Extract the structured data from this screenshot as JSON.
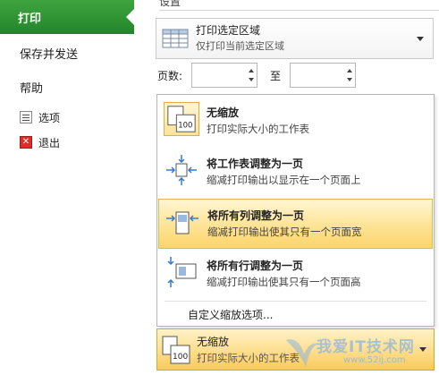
{
  "nav": {
    "items": [
      {
        "label": "打印",
        "active": true
      },
      {
        "label": "保存并发送"
      },
      {
        "label": "帮助"
      },
      {
        "label": "选项",
        "icon": "options-icon"
      },
      {
        "label": "退出",
        "icon": "exit-icon"
      }
    ]
  },
  "settings": {
    "section_title": "设置",
    "print_area": {
      "title": "打印选定区域",
      "description": "仅打印当前选定区域",
      "icon": "table-grid-icon"
    },
    "pages": {
      "label": "页数:",
      "to_label": "至",
      "from_value": "",
      "to_value": ""
    }
  },
  "scaling_menu": {
    "items": [
      {
        "title": "无缩放",
        "description": "打印实际大小的工作表",
        "icon": "page-100-icon",
        "current": true
      },
      {
        "title": "将工作表调整为一页",
        "description": "缩减打印输出以显示在一个页面上",
        "icon": "fit-sheet-icon"
      },
      {
        "title": "将所有列调整为一页",
        "description": "缩减打印输出使其只有一个页面宽",
        "icon": "fit-columns-icon",
        "hover": true
      },
      {
        "title": "将所有行调整为一页",
        "description": "缩减打印输出使其只有一个页面高",
        "icon": "fit-rows-icon"
      }
    ],
    "custom_label": "自定义缩放选项..."
  },
  "scaling_button": {
    "title": "无缩放",
    "description": "打印实际大小的工作表",
    "icon": "page-100-icon"
  },
  "watermark": {
    "text": "我爱IT技术网",
    "url": "www.52ij.com"
  },
  "colors": {
    "active_nav": "#2e9a32",
    "highlight": "#fde395",
    "highlight_border": "#e7b54a"
  }
}
